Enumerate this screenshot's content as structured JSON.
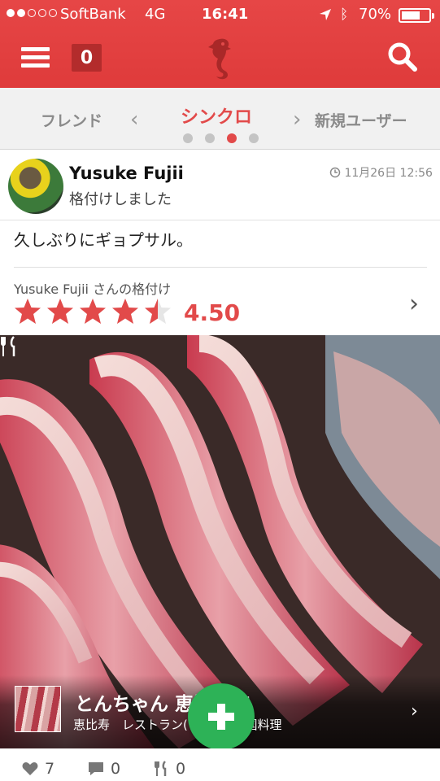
{
  "status_bar": {
    "carrier": "SoftBank",
    "network": "4G",
    "time": "16:41",
    "battery_text": "70%",
    "battery_level": 0.7,
    "signal_bars_on": 2,
    "signal_bars_total": 5
  },
  "header": {
    "notification_count": "0",
    "accent_color": "#e24a4a",
    "logo_icon": "seahorse-icon"
  },
  "tabs": {
    "left": "フレンド",
    "center": "シンクロ",
    "right": "新規ユーザー",
    "page_count": 4,
    "active_index": 2
  },
  "post": {
    "user_name": "Yusuke Fujii",
    "action": "格付けしました",
    "timestamp": "11月26日 12:56",
    "comment": "久しぶりにギョプサル。",
    "rating_label": "Yusuke Fujii さんの格付け",
    "rating": 4.5,
    "rating_text": "4.50",
    "stars_total": 5
  },
  "place": {
    "name": "とんちゃん 恵比寿店",
    "meta": "恵比寿　レストラン(その他),韓国料理"
  },
  "footer": {
    "likes": "7",
    "comments": "0",
    "forks": "0"
  }
}
